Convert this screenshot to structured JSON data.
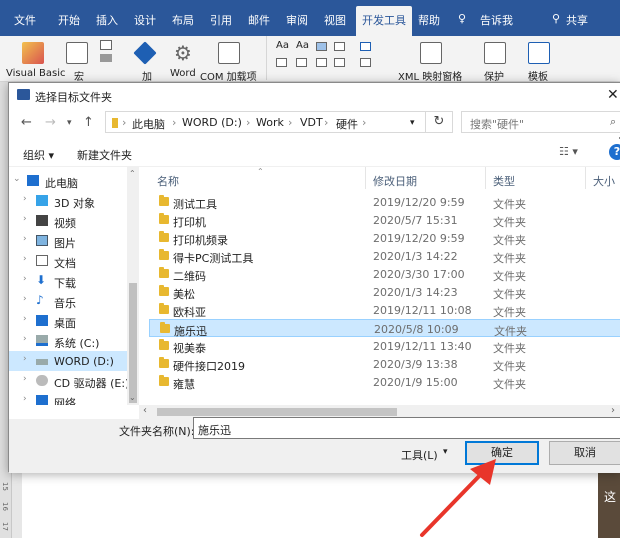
{
  "ribbon": {
    "tabs": [
      "文件",
      "开始",
      "插入",
      "设计",
      "布局",
      "引用",
      "邮件",
      "审阅",
      "视图",
      "开发工具",
      "帮助"
    ],
    "active_tab": "开发工具",
    "tell_me": "告诉我",
    "share": "共享",
    "groups": [
      "Visual Basic",
      "宏",
      "加",
      "Word",
      "COM 加载项",
      "XML 映射窗格",
      "保护",
      "模板"
    ]
  },
  "ruler_numbers": [
    "15",
    "16",
    "17"
  ],
  "document": {
    "right_text": "这"
  },
  "dialog": {
    "title": "选择目标文件夹",
    "breadcrumbs": [
      "此电脑",
      "WORD (D:)",
      "Work",
      "VDT",
      "硬件"
    ],
    "search_placeholder": "搜索\"硬件\"",
    "toolbar": {
      "organize": "组织 ▾",
      "new_folder": "新建文件夹"
    },
    "nav_items": [
      {
        "label": "此电脑",
        "icon": "computer-icon"
      },
      {
        "label": "3D 对象",
        "icon": "3d-objects-icon"
      },
      {
        "label": "视频",
        "icon": "video-icon"
      },
      {
        "label": "图片",
        "icon": "pictures-icon"
      },
      {
        "label": "文档",
        "icon": "documents-icon"
      },
      {
        "label": "下载",
        "icon": "download-icon"
      },
      {
        "label": "音乐",
        "icon": "music-icon"
      },
      {
        "label": "桌面",
        "icon": "desktop-icon"
      },
      {
        "label": "系统 (C:)",
        "icon": "drive-c-icon"
      },
      {
        "label": "WORD (D:)",
        "icon": "drive-d-icon"
      },
      {
        "label": "CD 驱动器 (E:)",
        "icon": "cd-drive-icon"
      },
      {
        "label": "网络",
        "icon": "network-icon"
      }
    ],
    "columns": {
      "name": "名称",
      "date": "修改日期",
      "type": "类型",
      "size": "大小"
    },
    "files": [
      {
        "name": "测试工具",
        "date": "2019/12/20 9:59",
        "type": "文件夹"
      },
      {
        "name": "打印机",
        "date": "2020/5/7 15:31",
        "type": "文件夹"
      },
      {
        "name": "打印机频录",
        "date": "2019/12/20 9:59",
        "type": "文件夹"
      },
      {
        "name": "得卡PC测试工具",
        "date": "2020/1/3 14:22",
        "type": "文件夹"
      },
      {
        "name": "二维码",
        "date": "2020/3/30 17:00",
        "type": "文件夹"
      },
      {
        "name": "美松",
        "date": "2020/1/3 14:23",
        "type": "文件夹"
      },
      {
        "name": "欧科亚",
        "date": "2019/12/11 10:08",
        "type": "文件夹"
      },
      {
        "name": "施乐迅",
        "date": "2020/5/8 10:09",
        "type": "文件夹"
      },
      {
        "name": "视美泰",
        "date": "2019/12/11 13:40",
        "type": "文件夹"
      },
      {
        "name": "硬件接口2019",
        "date": "2020/3/9 13:38",
        "type": "文件夹"
      },
      {
        "name": "雍慧",
        "date": "2020/1/9 15:00",
        "type": "文件夹"
      }
    ],
    "selected_file": "施乐迅",
    "folder_name_label": "文件夹名称(N):",
    "folder_name_value": "施乐迅",
    "tools_label": "工具(L)",
    "ok_label": "确定",
    "cancel_label": "取消"
  },
  "colors": {
    "ribbon_blue": "#2b579a",
    "selection": "#cce8ff",
    "arrow": "#e8352a",
    "folder": "#e8b830"
  }
}
